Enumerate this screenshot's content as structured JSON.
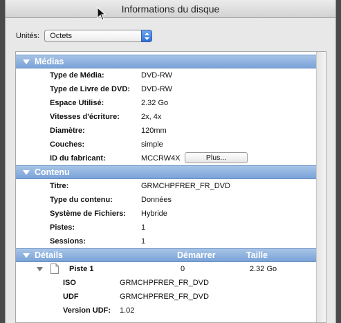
{
  "window": {
    "title": "Informations du disque"
  },
  "units": {
    "label": "Unités:",
    "selected": "Octets"
  },
  "medias": {
    "header": "Médias",
    "rows": [
      {
        "label": "Type de Média:",
        "value": "DVD-RW"
      },
      {
        "label": "Type de Livre de DVD:",
        "value": "DVD-RW"
      },
      {
        "label": "Espace Utilisé:",
        "value": "2.32 Go"
      },
      {
        "label": "Vitesses d'écriture:",
        "value": "2x, 4x"
      },
      {
        "label": "Diamètre:",
        "value": "120mm"
      },
      {
        "label": "Couches:",
        "value": "simple"
      },
      {
        "label": "ID du fabricant:",
        "value": "MCCRW4X",
        "button": "Plus..."
      }
    ]
  },
  "contenu": {
    "header": "Contenu",
    "rows": [
      {
        "label": "Titre:",
        "value": "GRMCHPFRER_FR_DVD"
      },
      {
        "label": "Type du contenu:",
        "value": "Données"
      },
      {
        "label": "Système de Fichiers:",
        "value": "Hybride"
      },
      {
        "label": "Pistes:",
        "value": "1"
      },
      {
        "label": "Sessions:",
        "value": "1"
      }
    ]
  },
  "details": {
    "header": "Détails",
    "col_start": "Démarrer",
    "col_size": "Taille",
    "track": {
      "name": "Piste 1",
      "start": "0",
      "size": "2.32 Go"
    },
    "rows": [
      {
        "label": "ISO",
        "value": "GRMCHPFRER_FR_DVD"
      },
      {
        "label": "UDF",
        "value": "GRMCHPFRER_FR_DVD"
      },
      {
        "label": "Version UDF:",
        "value": "1.02"
      }
    ]
  },
  "icons": {
    "cursor": "mouse-pointer-icon",
    "disclosure": "disclosure-triangle-icon",
    "document": "document-icon",
    "stepper": "up-down-arrows-icon"
  },
  "colors": {
    "section_header": "#7aa3d8",
    "select_stepper": "#2f6fd6"
  }
}
